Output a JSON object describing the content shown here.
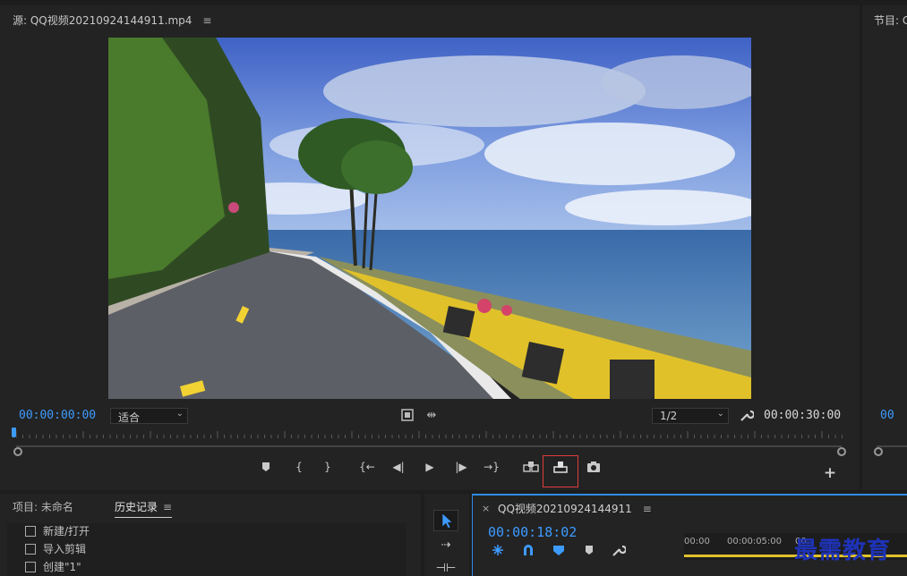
{
  "source": {
    "title": "源: QQ视频20210924144911.mp4",
    "menu_icon": "≡",
    "current_timecode": "00:00:00:00",
    "duration_timecode": "00:00:30:00",
    "zoom_select": "适合",
    "resolution_select": "1/2",
    "transport": [
      "marker-icon",
      "mark-in-icon",
      "mark-out-icon",
      "go-to-in-icon",
      "step-back-icon",
      "play-icon",
      "step-forward-icon",
      "go-to-out-icon",
      "insert-icon",
      "overwrite-icon",
      "export-frame-icon",
      "add-button-icon"
    ]
  },
  "program": {
    "title": "节目: C"
  },
  "project": {
    "tab_project": "项目: 未命名",
    "tab_history": "历史记录",
    "menu_icon": "≡",
    "history": [
      {
        "label": "新建/打开"
      },
      {
        "label": "导入剪辑"
      },
      {
        "label": "创建\"1\""
      }
    ]
  },
  "timeline": {
    "close_icon": "×",
    "title": "QQ视频20210924144911",
    "menu_icon": "≡",
    "timecode": "00:00:18:02",
    "ruler_labels": [
      "00:00",
      "00:00:05:00",
      "00:"
    ]
  },
  "watermark": "最需教育",
  "colors": {
    "accent": "#3d9bff",
    "highlight_box": "#e23c3c",
    "watermark": "#1e33b8"
  }
}
